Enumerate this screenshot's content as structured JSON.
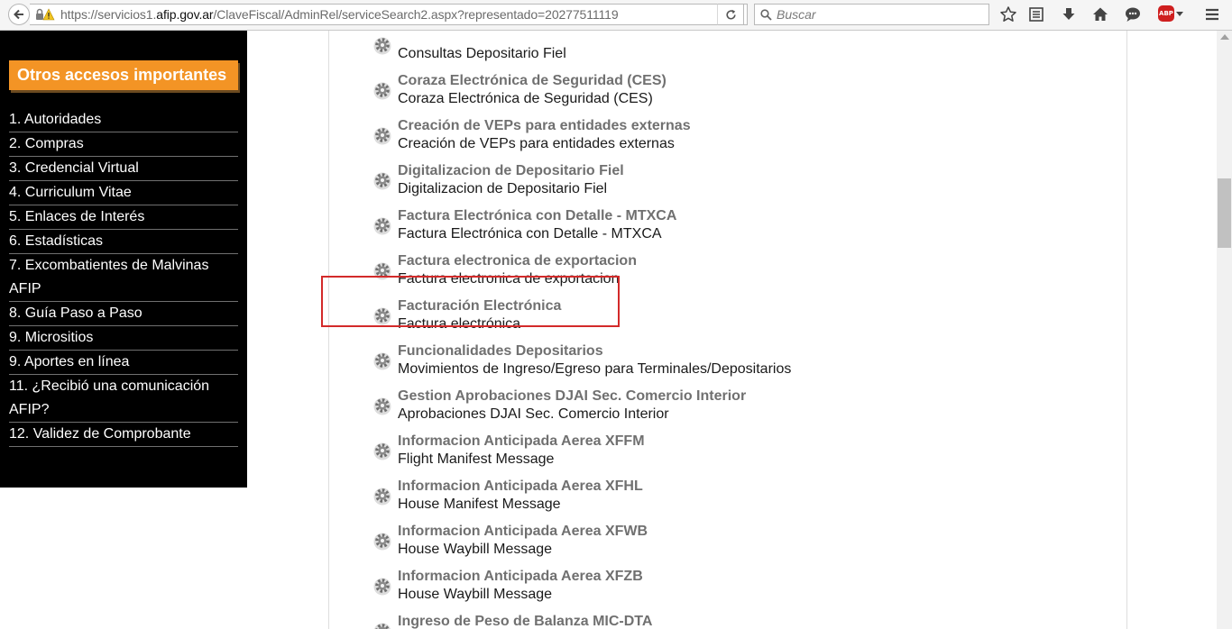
{
  "browser": {
    "url_prefix": "https://servicios1.",
    "url_host": "afip.gov.ar",
    "url_path": "/ClaveFiscal/AdminRel/serviceSearch2.aspx?representado=20277511119",
    "search_placeholder": "Buscar",
    "abp_label": "ABP",
    "toolbar_icons": [
      "bookmark-star-icon",
      "reading-list-icon",
      "downloads-icon",
      "home-icon",
      "chat-icon",
      "adblock-icon",
      "menu-icon"
    ]
  },
  "sidebar": {
    "heading": "Otros accesos importantes",
    "items": [
      {
        "label": "1. Autoridades"
      },
      {
        "label": "2. Compras"
      },
      {
        "label": "3. Credencial Virtual"
      },
      {
        "label": "4. Curriculum Vitae"
      },
      {
        "label": "5. Enlaces de Interés"
      },
      {
        "label": "6. Estadísticas"
      },
      {
        "label": "7. Excombatientes de Malvinas AFIP"
      },
      {
        "label": "8. Guía Paso a Paso"
      },
      {
        "label": "9. Micrositios"
      },
      {
        "label": "9. Aportes en línea"
      },
      {
        "label": "11. ¿Recibió una comunicación AFIP?"
      },
      {
        "label": "12. Validez de Comprobante"
      }
    ]
  },
  "services": [
    {
      "title": "",
      "description": "Consultas Depositario Fiel"
    },
    {
      "title": "Coraza Electrónica de Seguridad (CES)",
      "description": "Coraza Electrónica de Seguridad (CES)"
    },
    {
      "title": "Creación de VEPs para entidades externas",
      "description": "Creación de VEPs para entidades externas"
    },
    {
      "title": "Digitalizacion de Depositario Fiel",
      "description": "Digitalizacion de Depositario Fiel"
    },
    {
      "title": "Factura Electrónica con Detalle - MTXCA",
      "description": "Factura Electrónica con Detalle - MTXCA"
    },
    {
      "title": "Factura electronica de exportacion",
      "description": "Factura electronica de exportacion"
    },
    {
      "title": "Facturación Electrónica",
      "description": "Factura electrónica"
    },
    {
      "title": "Funcionalidades Depositarios",
      "description": "Movimientos de Ingreso/Egreso para Terminales/Depositarios"
    },
    {
      "title": "Gestion Aprobaciones DJAI Sec. Comercio Interior",
      "description": "Aprobaciones DJAI Sec. Comercio Interior"
    },
    {
      "title": "Informacion Anticipada Aerea XFFM",
      "description": "Flight Manifest Message"
    },
    {
      "title": "Informacion Anticipada Aerea XFHL",
      "description": "House Manifest Message"
    },
    {
      "title": "Informacion Anticipada Aerea XFWB",
      "description": "House Waybill Message"
    },
    {
      "title": "Informacion Anticipada Aerea XFZB",
      "description": "House Waybill Message"
    },
    {
      "title": "Ingreso de Peso de Balanza MIC-DTA",
      "description": ""
    }
  ],
  "colors": {
    "sidebar_bg": "#000000",
    "heading_bg": "#f39425",
    "highlight_border": "#d32a2a",
    "service_title": "#707070"
  }
}
